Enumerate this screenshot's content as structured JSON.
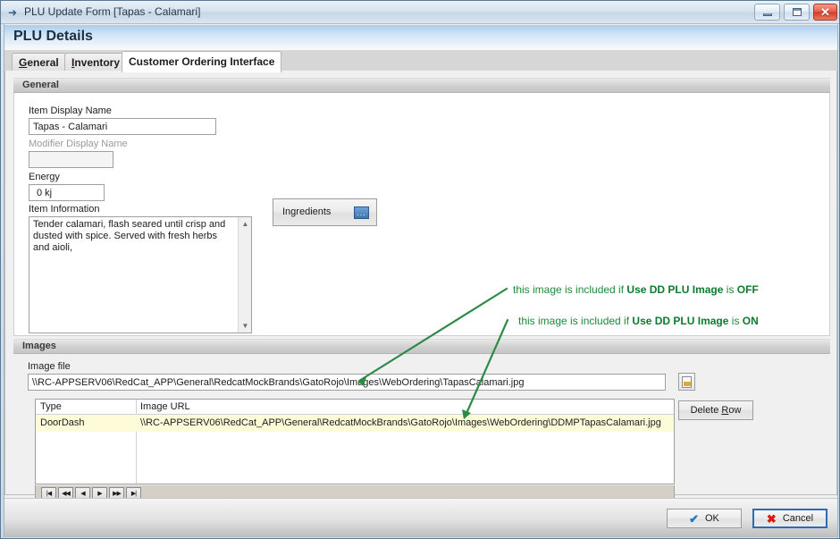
{
  "window": {
    "title": "PLU Update Form [Tapas - Calamari]",
    "icon": "arrow-window-icon",
    "controls": {
      "minimize": "minimize-icon",
      "maximize": "maximize-icon",
      "close": "✕"
    }
  },
  "header": {
    "title": "PLU Details"
  },
  "tabs": [
    {
      "label": "General",
      "mnemonic": "G",
      "active": false
    },
    {
      "label": "Inventory",
      "mnemonic": "I",
      "active": false
    },
    {
      "label": "Customer Ordering Interface",
      "mnemonic": "",
      "active": true
    }
  ],
  "general_group": {
    "title": "General",
    "item_display_name": {
      "label": "Item Display Name",
      "value": "Tapas - Calamari"
    },
    "modifier_display_name": {
      "label": "Modifier Display Name",
      "value": "",
      "disabled": true
    },
    "energy": {
      "label": "Energy",
      "value": "0 kj"
    },
    "item_information": {
      "label": "Item Information",
      "value": "Tender calamari, flash seared until crisp and dusted with spice. Served with fresh herbs and aioli,",
      "scroll_up_icon": "▲",
      "scroll_down_icon": "▼"
    },
    "ingredients_button": {
      "label": "Ingredients",
      "ellipsis": "..."
    }
  },
  "images_group": {
    "title": "Images",
    "image_file": {
      "label": "Image file",
      "value": "\\\\RC-APPSERV06\\RedCat_APP\\General\\RedcatMockBrands\\GatoRojo\\Images\\WebOrdering\\TapasCalamari.jpg"
    },
    "browse_button": "browse-file-icon",
    "grid": {
      "columns": [
        "Type",
        "Image URL"
      ],
      "rows": [
        {
          "type": "DoorDash",
          "url": "\\\\RC-APPSERV06\\RedCat_APP\\General\\RedcatMockBrands\\GatoRojo\\Images\\WebOrdering\\DDMPTapasCalamari.jpg"
        }
      ],
      "row_highlight_color": "#fdfbd8",
      "navigator": [
        {
          "name": "first",
          "glyph": "|◀"
        },
        {
          "name": "previous-page",
          "glyph": "◀◀"
        },
        {
          "name": "previous",
          "glyph": "◀"
        },
        {
          "name": "next",
          "glyph": "▶"
        },
        {
          "name": "next-page",
          "glyph": "▶▶"
        },
        {
          "name": "last",
          "glyph": "▶|"
        }
      ]
    },
    "delete_row_button": {
      "label": "Delete Row",
      "mnemonic": "R"
    }
  },
  "footer": {
    "ok_button": {
      "label": "OK",
      "icon": "✔"
    },
    "cancel_button": {
      "label": "Cancel",
      "icon": "✖",
      "focused": true
    }
  },
  "annotations": {
    "color": "#1f8a3c",
    "callout_off": {
      "prefix": "this image is included if ",
      "bold": "Use DD PLU Image",
      "middle": " is ",
      "state": "OFF"
    },
    "callout_on": {
      "prefix": "this image is included if ",
      "bold": "Use DD PLU Image",
      "middle": " is ",
      "state": "ON"
    }
  }
}
